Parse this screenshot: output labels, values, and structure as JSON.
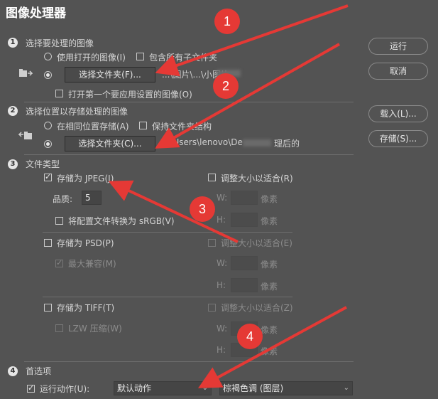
{
  "window": {
    "title": "图像处理器"
  },
  "section1": {
    "number": "1",
    "title": "选择要处理的图像",
    "use_open_label": "使用打开的图像(I)",
    "include_subfolders_label": "包含所有子文件夹",
    "select_folder_label": "选择文件夹(F)...",
    "folder_path": "...\\图片\\...\\小图片",
    "open_first_label": "打开第一个要应用设置的图像(O)"
  },
  "section2": {
    "number": "2",
    "title": "选择位置以存储处理的图像",
    "same_location_label": "在相同位置存储(A)",
    "keep_structure_label": "保持文件夹结构",
    "select_folder_label": "选择文件夹(C)...",
    "folder_path_start": "...\\Users\\lenovo\\De",
    "folder_path_end": "理后的"
  },
  "section3": {
    "number": "3",
    "title": "文件类型",
    "jpeg": {
      "save_label": "存储为 JPEG(J)",
      "resize_label": "调整大小以适合(R)",
      "quality_label": "品质:",
      "quality_value": "5",
      "w_label": "W:",
      "h_label": "H:",
      "px_label_w": "像素",
      "px_label_h": "像素",
      "srgb_label": "将配置文件转换为 sRGB(V)"
    },
    "psd": {
      "save_label": "存储为 PSD(P)",
      "resize_label": "调整大小以适合(E)",
      "compat_label": "最大兼容(M)",
      "w_label": "W:",
      "h_label": "H:",
      "px_label_w": "像素",
      "px_label_h": "像素"
    },
    "tiff": {
      "save_label": "存储为 TIFF(T)",
      "resize_label": "调整大小以适合(Z)",
      "lzw_label": "LZW 压缩(W)",
      "w_label": "W:",
      "h_label": "H:",
      "px_label_w": "像素",
      "px_label_h": "像素"
    }
  },
  "section4": {
    "number": "4",
    "title": "首选项",
    "run_action_label": "运行动作(U):",
    "action_set": "默认动作",
    "action": "棕褐色调 (图层)"
  },
  "side_buttons": {
    "run": "运行",
    "cancel": "取消",
    "load": "载入(L)...",
    "save": "存储(S)..."
  },
  "annotations": [
    "1",
    "2",
    "3",
    "4"
  ],
  "colors": {
    "annotation_red": "#e53935",
    "panel_bg": "#535353"
  }
}
